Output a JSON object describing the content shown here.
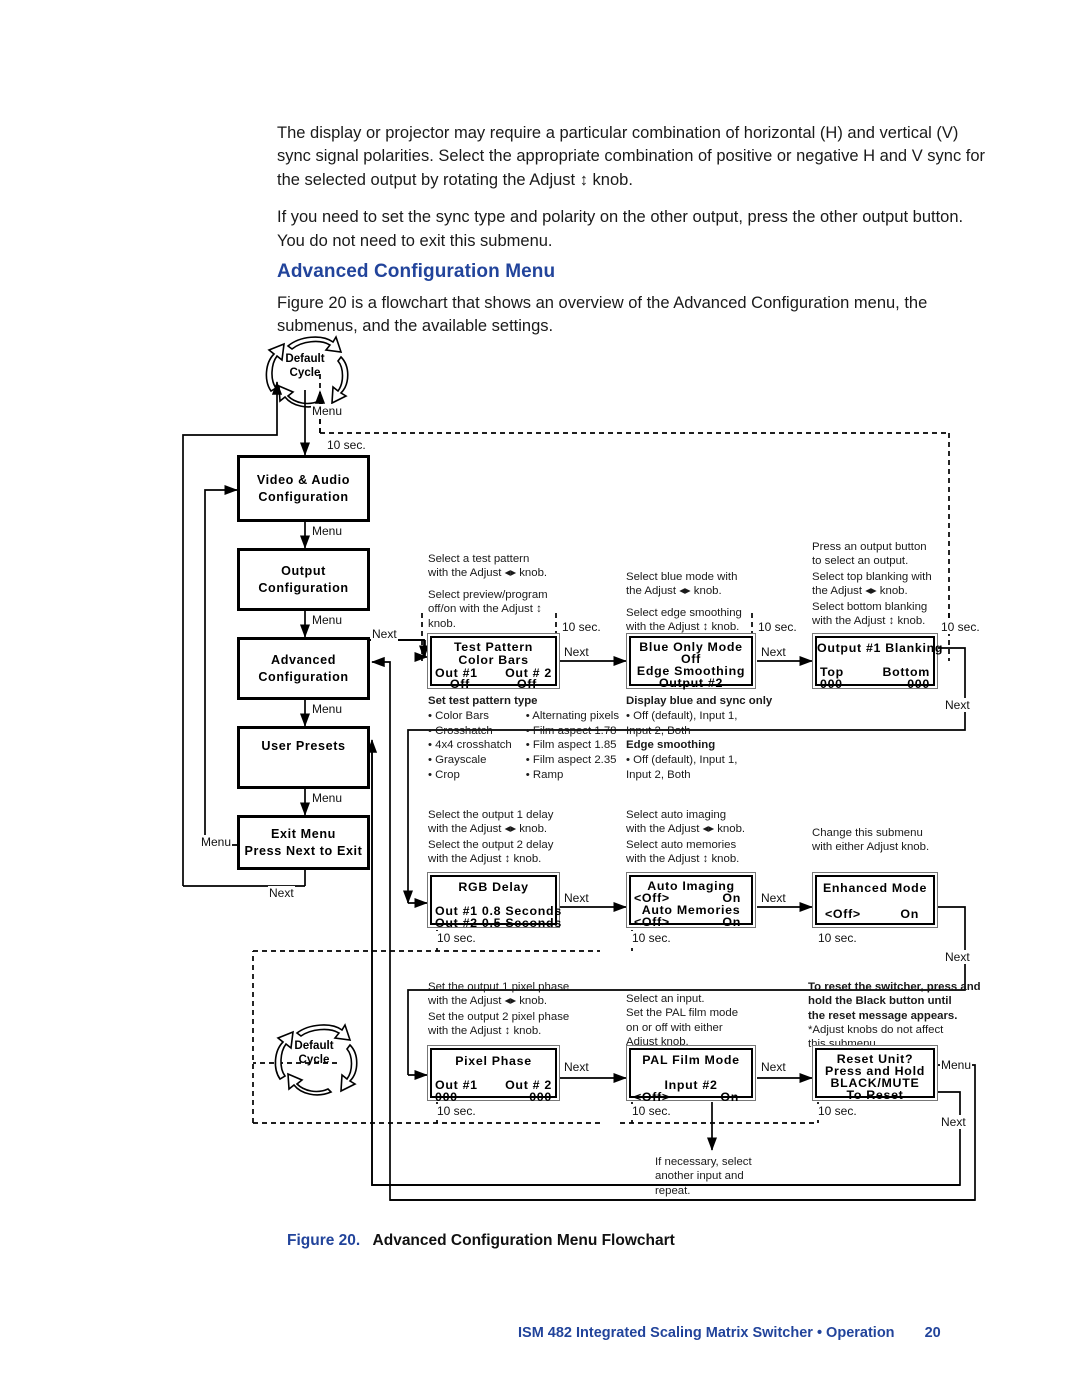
{
  "body_text": {
    "para1": "The display or projector may require a particular combination of horizontal (H) and vertical (V) sync signal polarities.  Select the appropriate combination of positive or negative H and V sync for the selected output by rotating the Adjust ↕ knob.",
    "para2": "If you need to set the sync type and polarity on the other output, press the other output button.  You do not need to exit this submenu.",
    "section_heading": "Advanced Configuration Menu",
    "para3": "Figure 20 is a flowchart that shows an overview of the Advanced Configuration menu, the submenus, and the available settings."
  },
  "figure": {
    "caption_number": "Figure 20.",
    "caption_title": "Advanced Configuration Menu Flowchart"
  },
  "footer": {
    "text": "ISM 482 Integrated Scaling Matrix Switcher • Operation",
    "page_number": "20"
  },
  "flowchart": {
    "default_cycle_top": "Default\nCycle",
    "default_cycle_bottom": "Default\nCycle",
    "main_menu_boxes": [
      {
        "label": "Video & Audio\nConfiguration"
      },
      {
        "label": "Output\nConfiguration"
      },
      {
        "label": "Advanced\nConfiguration"
      },
      {
        "label": "User Presets"
      },
      {
        "label": "Exit Menu\nPress Next to Exit"
      }
    ],
    "edge_labels": {
      "menu_top": "Menu",
      "menu_1": "Menu",
      "menu_2": "Menu",
      "menu_3": "Menu",
      "menu_4": "Menu",
      "menu_exit_left": "Menu",
      "next_exit": "Next",
      "next_advanced": "Next",
      "ten_sec_top": "10 sec.",
      "ten_sec_r1a": "10 sec.",
      "ten_sec_r1b": "10 sec.",
      "ten_sec_r1c": "10 sec.",
      "next_r1a": "Next",
      "next_r1b": "Next",
      "next_r1_down": "Next",
      "ten_sec_r2a": "10 sec.",
      "ten_sec_r2b": "10 sec.",
      "ten_sec_r2c": "10 sec.",
      "next_r2a": "Next",
      "next_r2b": "Next",
      "next_r2_down": "Next",
      "ten_sec_r3a": "10 sec.",
      "ten_sec_r3b": "10 sec.",
      "ten_sec_r3c": "10 sec.",
      "next_r3a": "Next",
      "next_r3b": "Next",
      "menu_reset": "Menu",
      "next_reset": "Next"
    },
    "annotations": {
      "test_pattern_note": "Select a test pattern\nwith the Adjust ◂▸ knob.",
      "test_pattern_note2": "Select preview/program\noff/on with the Adjust ↕\nknob.",
      "blue_only_note": "Select blue mode with\nthe Adjust ◂▸ knob.",
      "blue_only_note2": "Select edge smoothing\nwith the Adjust ↕ knob.",
      "blanking_note": "Press an output button\nto select an output.",
      "blanking_note2": "Select top blanking with\nthe Adjust ◂▸ knob.",
      "blanking_note3": "Select bottom blanking\nwith the Adjust ↕ knob.",
      "rgb_delay_note": "Select the output 1 delay\nwith the Adjust ◂▸ knob.",
      "rgb_delay_note2": "Select the output 2 delay\nwith the Adjust ↕ knob.",
      "auto_imaging_note": "Select auto imaging\nwith the Adjust ◂▸ knob.",
      "auto_imaging_note2": "Select auto memories\nwith the Adjust ↕ knob.",
      "enhanced_note": "Change this submenu\nwith either Adjust knob.",
      "pixel_phase_note": "Set the output 1 pixel phase\nwith the Adjust ◂▸ knob.",
      "pixel_phase_note2": "Set the output 2 pixel phase\nwith the Adjust ↕ knob.",
      "pal_note": "Select an input.\nSet the PAL film mode\non or off with either\nAdjust knob.",
      "reset_note_bold": "To reset the switcher, press and\nhold the Black button until\nthe reset message appears.",
      "reset_note": "*Adjust knobs do not affect\n this submenu.",
      "repeat_note": "If necessary, select\nanother input and\nrepeat."
    },
    "submenus": {
      "test_pattern": {
        "line1": "Test Pattern",
        "line2": "Color Bars",
        "line3_left": "Out #1",
        "line3_right": "Out # 2",
        "line4_left": "Off",
        "line4_right": "Off"
      },
      "blue_only": {
        "line1": "Blue Only Mode",
        "line2": "Off",
        "line3": "Edge Smoothing",
        "line4": "Output #2"
      },
      "blanking": {
        "line1": "Output #1 Blanking",
        "line3_left": "Top",
        "line3_right": "Bottom",
        "line4_left": "000",
        "line4_right": "000"
      },
      "rgb_delay": {
        "line1": "RGB Delay",
        "line3": "Out #1  0.8 Seconds",
        "line4": "Out #2  0.5 Seconds"
      },
      "auto_imaging": {
        "line1": "Auto Imaging",
        "line2_left": "<Off>",
        "line2_right": "On",
        "line3": "Auto Memories",
        "line4_left": "<Off>",
        "line4_right": "On"
      },
      "enhanced_mode": {
        "line1": "Enhanced Mode",
        "line3_left": "<Off>",
        "line3_right": "On"
      },
      "pixel_phase": {
        "line1": "Pixel Phase",
        "line3_left": "Out #1",
        "line3_right": "Out # 2",
        "line4_left": "000",
        "line4_right": "000"
      },
      "pal_film": {
        "line1": "PAL Film Mode",
        "line3": "Input #2",
        "line4_left": "<Off>",
        "line4_right": "On"
      },
      "reset_unit": {
        "line1": "Reset Unit?",
        "line2": "Press and Hold",
        "line3": "BLACK/MUTE",
        "line4": "To Reset"
      }
    },
    "bullet_lists": {
      "test_pattern_header": "Set test pattern type",
      "test_pattern_col1": "• Color Bars\n• Crosshatch\n• 4x4 crosshatch\n• Grayscale\n• Crop",
      "test_pattern_col2": "• Alternating pixels\n• Film aspect 1.78\n• Film aspect 1.85\n• Film aspect 2.35\n• Ramp",
      "blue_header": "Display blue and sync only",
      "blue_items": "• Off (default), Input 1,\n  Input 2, Both",
      "edge_header": "Edge smoothing",
      "edge_items": "• Off (default), Input 1,\n  Input 2, Both"
    }
  }
}
